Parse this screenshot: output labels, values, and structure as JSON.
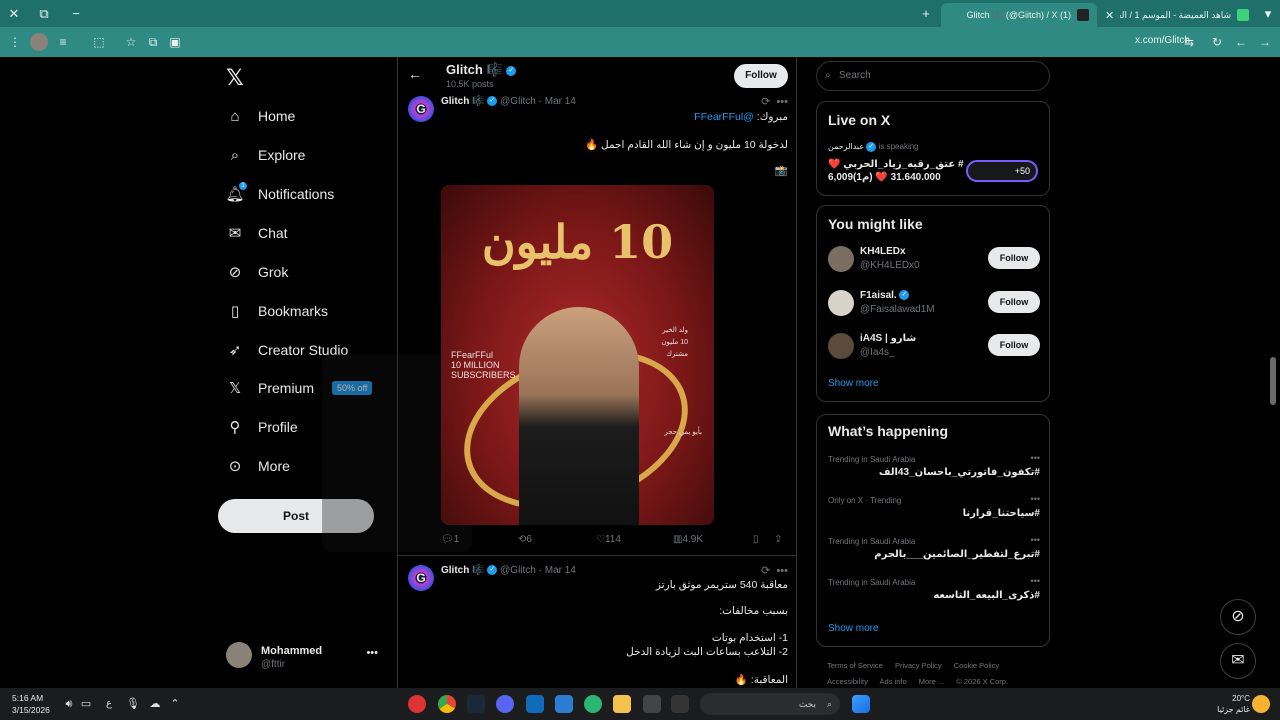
{
  "browser": {
    "tabs": [
      {
        "title": "شاهد العميضة - الموسم 1 / الحلقة",
        "active": false
      },
      {
        "title": "(1) Glitch 🎼 (@Giitch) / X",
        "active": true
      }
    ],
    "url": "x.com/Glitch"
  },
  "nav": {
    "items": [
      {
        "label": "Home",
        "icon": "home-icon"
      },
      {
        "label": "Explore",
        "icon": "search-icon"
      },
      {
        "label": "Notifications",
        "icon": "bell-icon",
        "badge": "1"
      },
      {
        "label": "Chat",
        "icon": "mail-icon"
      },
      {
        "label": "Grok",
        "icon": "grok-icon"
      },
      {
        "label": "Bookmarks",
        "icon": "bookmark-icon"
      },
      {
        "label": "Creator Studio",
        "icon": "rocket-icon"
      },
      {
        "label": "Premium",
        "icon": "x-icon",
        "promo": "50% off"
      },
      {
        "label": "Profile",
        "icon": "person-icon"
      },
      {
        "label": "More",
        "icon": "more-icon"
      }
    ],
    "post_label": "Post",
    "account": {
      "name": "Mohammed",
      "handle": "@fttir"
    }
  },
  "header": {
    "title": "Glitch 🎼",
    "subtitle": "10.5K posts",
    "follow_label": "Follow"
  },
  "tweets": [
    {
      "name": "Glitch 🎼",
      "handle": "@Glitch",
      "date": "Mar 14",
      "mention": "@FFearFFul",
      "line1": "مبروك",
      "line2": "لدخولة 10 مليون و إن شاء الله القادم اجمل 🔥",
      "line3": "📸",
      "media": {
        "title": "10 مليون",
        "brand": "FFearFFul\n10 MILLION\nSUBSCRIBERS",
        "side": "ولد الخير\n10 مليون\nمشترك",
        "credit": "بأيو يمن حجر"
      },
      "stats": {
        "replies": "1",
        "reposts": "6",
        "likes": "114",
        "views": "4.9K"
      }
    },
    {
      "name": "Glitch 🎼",
      "handle": "@Glitch",
      "date": "Mar 14",
      "lines": [
        "معاقبة 540 ستريمر موثق بارتز",
        "بسبب مخالفات:",
        "1- استخدام بوتات",
        "2- التلاعب بساعات البث لزيادة الدخل",
        "المعاقبة: 🔥"
      ]
    }
  ],
  "right": {
    "search_placeholder": "Search",
    "live": {
      "title": "Live on X",
      "host": "عبدالرحمن",
      "speaking": "is speaking",
      "space_title": "# عتق_رقبه_زياد_الحربي ❤️ 31.640.000 ❤️ (م1)6,009",
      "count": "+50"
    },
    "you_might_like": {
      "title": "You might like",
      "users": [
        {
          "name": "KH4LEDx",
          "handle": "@KH4LEDx0",
          "verified": false
        },
        {
          "name": "F1aisal.",
          "handle": "@Faisalawad1M",
          "verified": true
        },
        {
          "name": "iA4S | شارو",
          "handle": "@Ia4s_",
          "verified": false
        }
      ],
      "follow_label": "Follow",
      "show_more": "Show more"
    },
    "happening": {
      "title": "What’s happening",
      "trends": [
        {
          "meta": "Trending in Saudi Arabia",
          "topic": "#تكفون_فاتورتي_باحسان_43الف"
        },
        {
          "meta": "Only on X · Trending",
          "topic": "#سياحتنا_قرارنا"
        },
        {
          "meta": "Trending in Saudi Arabia",
          "topic": "#تبرع_لتفطير_الصائمين___بالحرم"
        },
        {
          "meta": "Trending in Saudi Arabia",
          "topic": "#ذكرى_البيعه_التاسعه"
        }
      ],
      "show_more": "Show more"
    },
    "footer": [
      "Terms of Service",
      "Privacy Policy",
      "Cookie Policy",
      "Accessibility",
      "Ads info",
      "More ...",
      "© 2026 X Corp."
    ]
  },
  "taskbar": {
    "time": "5:16 AM",
    "date": "3/15/2026",
    "search": "بحث",
    "weather_temp": "20°C",
    "weather_desc": "غائم جزئيا"
  }
}
